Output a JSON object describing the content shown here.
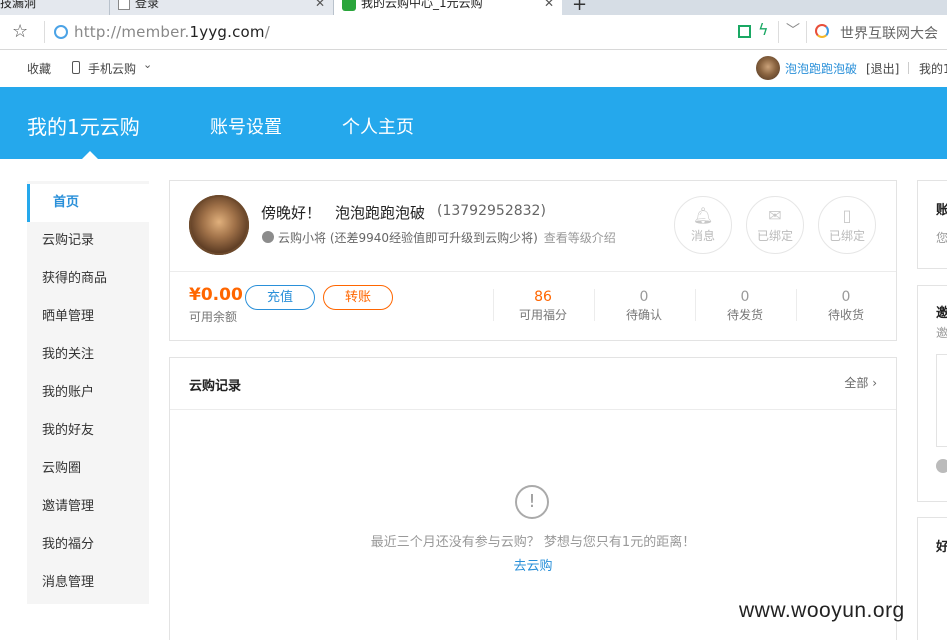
{
  "browser": {
    "tabs": [
      {
        "label": "技漏洞"
      },
      {
        "label": "登录"
      },
      {
        "label": "我的云购中心_1元云购"
      }
    ],
    "new_tab_label": "+",
    "url_prefix": "http://member.",
    "url_domain": "1yyg.com",
    "url_suffix": "/",
    "search_placeholder": "世界互联网大会"
  },
  "sitebar": {
    "favorites": "收藏",
    "mobile": "手机云购",
    "username": "泡泡跑跑泡破",
    "logout": "[退出]",
    "mine": "我的1"
  },
  "header": {
    "main": "我的1元云购",
    "account": "账号设置",
    "home": "个人主页"
  },
  "sidebar": {
    "items": [
      {
        "label": "首页",
        "active": true
      },
      {
        "label": "云购记录"
      },
      {
        "label": "获得的商品"
      },
      {
        "label": "晒单管理"
      },
      {
        "label": "我的关注"
      },
      {
        "label": "我的账户"
      },
      {
        "label": "我的好友"
      },
      {
        "label": "云购圈"
      },
      {
        "label": "邀请管理"
      },
      {
        "label": "我的福分"
      },
      {
        "label": "消息管理"
      }
    ]
  },
  "user": {
    "greeting": "傍晚好！",
    "nickname": "泡泡跑跑泡破",
    "phone": "(13792952832)",
    "level_name": "云购小将",
    "level_hint": "(还差9940经验值即可升级到云购少将)",
    "level_link": "查看等级介绍",
    "buttons": {
      "message": "消息",
      "email": "已绑定",
      "mobile": "已绑定"
    },
    "balance": "¥0.00",
    "balance_label": "可用余额",
    "recharge": "充值",
    "transfer": "转账",
    "stats": [
      {
        "value": "86",
        "label": "可用福分"
      },
      {
        "value": "0",
        "label": "待确认"
      },
      {
        "value": "0",
        "label": "待发货"
      },
      {
        "value": "0",
        "label": "待收货"
      }
    ]
  },
  "records": {
    "title": "云购记录",
    "all": "全部",
    "empty_text": "最近三个月还没有参与云购？ 梦想与您只有1元的距离！",
    "empty_link": "去云购"
  },
  "right": {
    "p1_title": "账",
    "p1_sub": "您",
    "p2_title": "邀",
    "p2_sub": "邀",
    "p3_title": "好"
  },
  "watermark": "www.wooyun.org",
  "colors": {
    "brand_blue": "#25a8ec",
    "link_blue": "#2a90d9",
    "accent_orange": "#ff6600"
  }
}
